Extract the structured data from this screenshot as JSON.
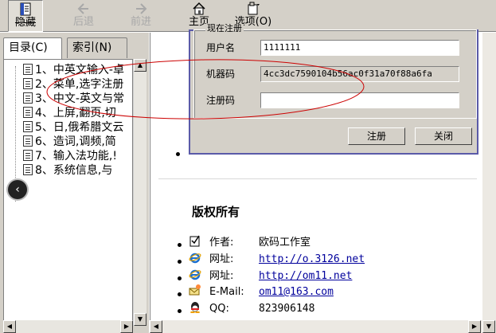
{
  "toolbar": {
    "buttons": [
      {
        "label": "隐藏",
        "icon": "hide-pane-icon"
      },
      {
        "label": "后退",
        "icon": "back-arrow-icon"
      },
      {
        "label": "前进",
        "icon": "forward-arrow-icon"
      },
      {
        "label": "主页",
        "icon": "home-icon"
      },
      {
        "label": "选项(O)",
        "icon": "options-icon"
      }
    ]
  },
  "nav": {
    "tabs": [
      {
        "label": "目录(C)"
      },
      {
        "label": "索引(N)"
      }
    ],
    "items": [
      {
        "label": "1、中英文输入-卓"
      },
      {
        "label": "2、菜单,选字注册"
      },
      {
        "label": "3、中文-英文与常"
      },
      {
        "label": "4、上屏,翻页,切"
      },
      {
        "label": "5、日,俄希腊文云"
      },
      {
        "label": "6、造词,调频,简"
      },
      {
        "label": "7、输入法功能,!"
      },
      {
        "label": "8、系统信息,与"
      }
    ]
  },
  "dialog": {
    "group_title": "现在注册",
    "username_label": "用户名",
    "username_value": "1111111",
    "machine_label": "机器码",
    "machine_value": "4cc3dc7590104b56ac0f31a70f88a6fa",
    "regcode_label": "注册码",
    "regcode_value": "",
    "register_button": "注册",
    "close_button": "关闭"
  },
  "copyright": {
    "title": "版权所有",
    "rows": [
      {
        "label": "作者:",
        "value": "欧码工作室",
        "icon": "author-icon",
        "link": false
      },
      {
        "label": "网址:",
        "value": "http://o.3126.net",
        "icon": "ie-browser-icon",
        "link": true
      },
      {
        "label": "网址:",
        "value": "http://om11.net",
        "icon": "ie-browser-icon",
        "link": true
      },
      {
        "label": "E-Mail:",
        "value": "om11@163.com",
        "icon": "email-icon",
        "link": true
      },
      {
        "label": "QQ:",
        "value": "823906148",
        "icon": "qq-icon",
        "link": false
      }
    ]
  },
  "colors": {
    "toolbar_bg": "#d4d0c8",
    "annotation_red": "#cc0000",
    "link_blue": "#00009c"
  }
}
